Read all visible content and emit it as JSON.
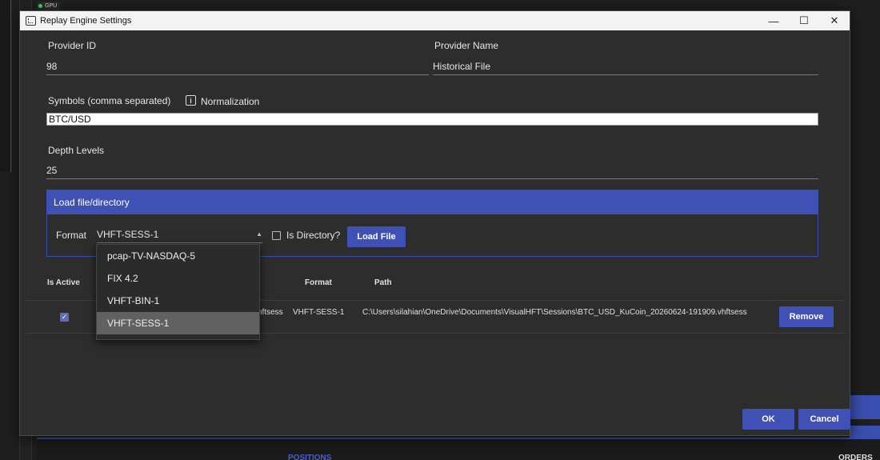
{
  "background": {
    "gpu_badge": "GPU",
    "tab_positions": "POSITIONS",
    "tab_orders": "ORDERS"
  },
  "dialog": {
    "title": "Replay Engine Settings",
    "icons": {
      "app": "settings-window-icon",
      "minimize": "minimize-icon",
      "maximize": "maximize-icon",
      "close": "close-icon"
    },
    "minimize_glyph": "—",
    "maximize_glyph": "☐",
    "close_glyph": "✕"
  },
  "form": {
    "provider_id_label": "Provider ID",
    "provider_id_value": "98",
    "provider_name_label": "Provider Name",
    "provider_name_value": "Historical File",
    "symbols_label": "Symbols (comma separated)",
    "symbols_value": "BTC/USD",
    "normalization_label": "Normalization",
    "info_glyph": "i",
    "depth_label": "Depth Levels",
    "depth_value": "25"
  },
  "load": {
    "header": "Load file/directory",
    "format_label": "Format",
    "format_selected": "VHFT-SESS-1",
    "dropdown_arrow": "▲",
    "is_directory_label": "Is Directory?",
    "is_directory_checked": false,
    "load_button": "Load File",
    "format_options": [
      "pcap-TV-NASDAQ-5",
      "FIX 4.2",
      "VHFT-BIN-1",
      "VHFT-SESS-1"
    ],
    "selected_index": 3
  },
  "table": {
    "headers": {
      "is_active": "Is Active",
      "format": "Format",
      "path": "Path"
    },
    "rows": [
      {
        "is_active": true,
        "check_glyph": "✓",
        "name_partial": "hftsess",
        "format": "VHFT-SESS-1",
        "path": "C:\\Users\\silahian\\OneDrive\\Documents\\VisualHFT\\Sessions\\BTC_USD_KuCoin_20260624-191909.vhftsess",
        "remove_label": "Remove"
      }
    ]
  },
  "footer": {
    "ok_label": "OK",
    "cancel_label": "Cancel"
  },
  "colors": {
    "accent": "#3f51b5",
    "dialog_bg": "#2d2d2d",
    "titlebar_bg": "#f3f3f3",
    "selected_item_bg": "#616161"
  }
}
